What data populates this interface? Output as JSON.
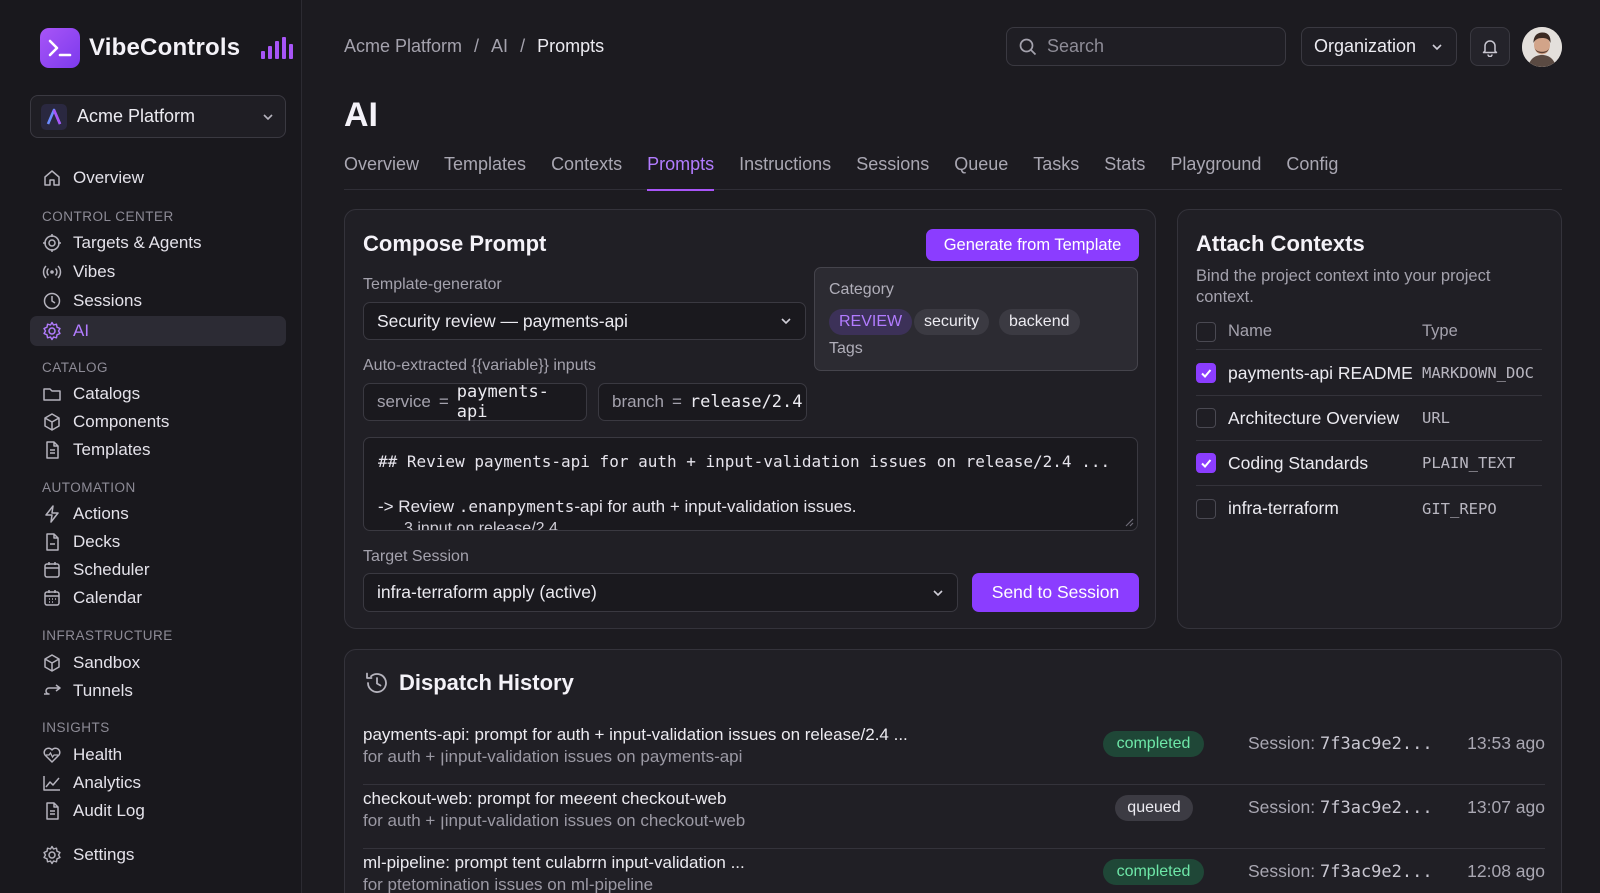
{
  "app": {
    "name": "VibeControls",
    "workspace": "Acme Platform"
  },
  "colors": {
    "accent": "#8b3dff",
    "accent_text": "#b27cff",
    "background": "#1c1b20",
    "status_completed": "#6ee7a8",
    "status_queued": "#ecebf1"
  },
  "sidebar": {
    "overview": {
      "label": "Overview",
      "icon": "home-icon"
    },
    "sections": {
      "control_center": "CONTROL CENTER",
      "catalog": "CATALOG",
      "automation": "AUTOMATION",
      "infrastructure": "INFRASTRUCTURE",
      "insights": "INSIGHTS"
    },
    "control_center": [
      {
        "label": "Targets & Agents",
        "icon": "target-icon"
      },
      {
        "label": "Vibes",
        "icon": "broadcast-icon"
      },
      {
        "label": "Sessions",
        "icon": "clock-icon"
      },
      {
        "label": "AI",
        "icon": "gear-icon",
        "active": true
      }
    ],
    "catalog": [
      {
        "label": "Catalogs",
        "icon": "folder-icon"
      },
      {
        "label": "Components",
        "icon": "cube-icon"
      },
      {
        "label": "Templates",
        "icon": "file-icon"
      }
    ],
    "automation": [
      {
        "label": "Actions",
        "icon": "bolt-icon"
      },
      {
        "label": "Decks",
        "icon": "file-icon"
      },
      {
        "label": "Scheduler",
        "icon": "calendar-icon"
      },
      {
        "label": "Calendar",
        "icon": "calendar-grid-icon"
      }
    ],
    "infrastructure": [
      {
        "label": "Sandbox",
        "icon": "cube-icon"
      },
      {
        "label": "Tunnels",
        "icon": "tunnel-icon"
      }
    ],
    "insights": [
      {
        "label": "Health",
        "icon": "heart-pulse-icon"
      },
      {
        "label": "Analytics",
        "icon": "chart-line-icon"
      },
      {
        "label": "Audit Log",
        "icon": "file-icon"
      }
    ],
    "settings": {
      "label": "Settings",
      "icon": "gear-icon"
    }
  },
  "header": {
    "breadcrumb": [
      "Acme Platform",
      "/",
      "AI",
      "/",
      "Prompts"
    ],
    "search_placeholder": "Search",
    "org_select": "Organization"
  },
  "page": {
    "title": "AI",
    "tabs": [
      "Overview",
      "Templates",
      "Contexts",
      "Prompts",
      "Instructions",
      "Sessions",
      "Queue",
      "Tasks",
      "Stats",
      "Playground",
      "Config"
    ],
    "active_tab": "Prompts"
  },
  "compose": {
    "title": "Compose Prompt",
    "generate_button": "Generate from Template",
    "template_label": "Template-generator",
    "template_value": "Security review — payments-api",
    "vars_label": "Auto-extracted {{variable}} inputs",
    "vars": [
      {
        "name": "service",
        "eq": "=",
        "value": "payments-api"
      },
      {
        "name": "branch",
        "eq": "=",
        "value": "release/2.4"
      }
    ],
    "category_label": "Category",
    "tags": [
      "REVIEW",
      "security",
      "backend"
    ],
    "tags_label": "Tags",
    "editor_line1": "## Review payments-api for auth + input-validation issues on release/2.4 ...",
    "editor_line2_prefix": "-> Review ",
    "editor_line2_code": ".enanpyments",
    "editor_line2_suffix": "-api for auth + input-validation issues.",
    "editor_line3": "3 input on release/2.4",
    "session_label": "Target Session",
    "session_value": "infra-terraform apply (active)",
    "send_button": "Send to Session"
  },
  "contexts": {
    "title": "Attach Contexts",
    "description": "Bind the project context into your project context.",
    "col_name": "Name",
    "col_type": "Type",
    "rows": [
      {
        "name": "payments-api README",
        "type": "MARKDOWN_DOC",
        "checked": true
      },
      {
        "name": "Architecture Overview",
        "type": "URL",
        "checked": false
      },
      {
        "name": "Coding Standards",
        "type": "PLAIN_TEXT",
        "checked": true
      },
      {
        "name": "infra-terraform",
        "type": "GIT_REPO",
        "checked": false
      }
    ]
  },
  "history": {
    "title": "Dispatch History",
    "session_prefix": "Session:",
    "rows": [
      {
        "title": "payments-api: prompt for auth + input-validation issues on release/2.4 ...",
        "subtitle": "for auth + ꞁinput-validation issues on payments-api",
        "status": "completed",
        "session": "7f3ac9e2...",
        "time": "13:53 ago"
      },
      {
        "title": "checkout-web: prompt for meℯent checkout-web",
        "subtitle": "for auth + ꞁinput-validation issues on checkout-web",
        "status": "queued",
        "session": "7f3ac9e2...",
        "time": "13:07 ago"
      },
      {
        "title": "ml-pipeline: prompt tent culabrrn input-validation ...",
        "subtitle": "for ptetomination issues on ml-pipeline",
        "status": "completed",
        "session": "7f3ac9e2...",
        "time": "12:08 ago"
      }
    ]
  }
}
